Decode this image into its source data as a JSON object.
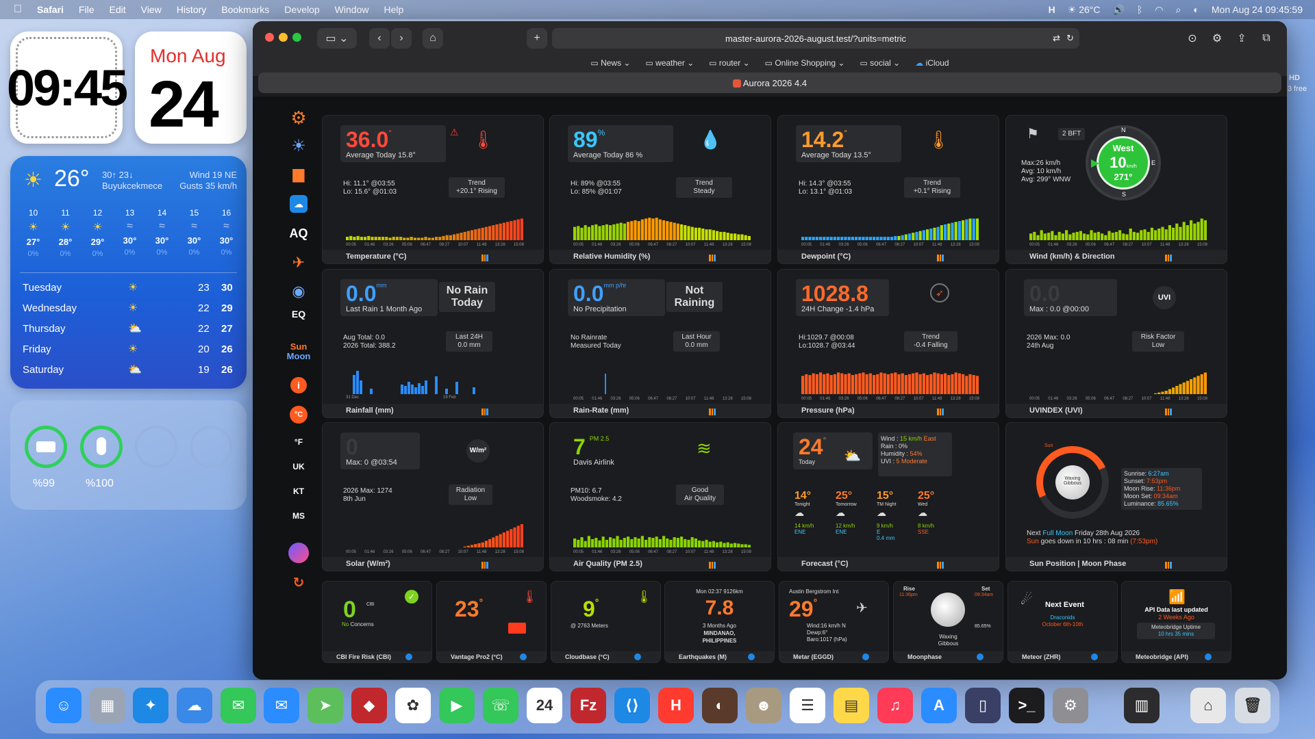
{
  "menubar": {
    "app": "Safari",
    "menus": [
      "File",
      "Edit",
      "View",
      "History",
      "Bookmarks",
      "Develop",
      "Window",
      "Help"
    ],
    "temp": "26°C",
    "datetime": "Mon Aug 24  09:45:59"
  },
  "widgets": {
    "clock": "09:45",
    "date_day": "Mon Aug",
    "date_num": "24",
    "weather": {
      "temp": "26°",
      "hilo": "30↑ 23↓",
      "location": "Buyukcekmece",
      "wind": "Wind 19 NE",
      "gusts": "Gusts 35 km/h",
      "hours": [
        "10",
        "11",
        "12",
        "13",
        "14",
        "15",
        "16"
      ],
      "hour_temps": [
        "27°",
        "28°",
        "29°",
        "30°",
        "30°",
        "30°",
        "30°"
      ],
      "hour_pops": [
        "0%",
        "0%",
        "0%",
        "0%",
        "0%",
        "0%",
        "0%"
      ],
      "days": [
        {
          "name": "Tuesday",
          "lo": "23",
          "hi": "30"
        },
        {
          "name": "Wednesday",
          "lo": "22",
          "hi": "29"
        },
        {
          "name": "Thursday",
          "lo": "22",
          "hi": "27"
        },
        {
          "name": "Friday",
          "lo": "20",
          "hi": "26"
        },
        {
          "name": "Saturday",
          "lo": "19",
          "hi": "26"
        }
      ]
    },
    "battery": [
      {
        "label": "%99",
        "level": 0.99
      },
      {
        "label": "%100",
        "level": 1.0
      }
    ],
    "side_text": [
      "HD",
      "3 free"
    ]
  },
  "browser": {
    "url": "master-aurora-2026-august.test/?units=metric",
    "bookmarks": [
      "News",
      "weather",
      "router",
      "Online Shopping",
      "social",
      "iCloud"
    ],
    "tab_title": "Aurora 2026 4.4"
  },
  "sidebar": {
    "aq": "AQ",
    "eq": "EQ",
    "sun": "Sun",
    "moon": "Moon",
    "units": [
      "°C",
      "°F",
      "UK",
      "KT",
      "MS"
    ]
  },
  "cards": {
    "temperature": {
      "value": "36.0",
      "unit": "°",
      "avg": "Average Today 15.8°",
      "hi": "Hi: 11.1° @03:55",
      "lo": "Lo: 15.6° @01:03",
      "trend_title": "Trend",
      "trend": "+20.1° Rising",
      "footer": "Temperature (°C)"
    },
    "humidity": {
      "value": "89",
      "unit": "%",
      "avg": "Average Today 86 %",
      "hi": "Hi: 89% @03:55",
      "lo": "Lo: 85% @01:07",
      "trend_title": "Trend",
      "trend": "Steady",
      "footer": "Relative Humidity (%)"
    },
    "dewpoint": {
      "value": "14.2",
      "unit": "°",
      "avg": "Average Today 13.5°",
      "hi": "Hi: 14.3° @03:55",
      "lo": "Lo: 13.1° @01:03",
      "trend_title": "Trend",
      "trend": "+0.1° Rising",
      "footer": "Dewpoint (°C)"
    },
    "wind": {
      "bft": "2 BFT",
      "max": "Max:26 km/h",
      "avg": "Avg: 10 km/h",
      "dir_avg": "Avg: 299° WNW",
      "dir": "West",
      "speed": "10",
      "speed_unit": "km/h",
      "deg": "271°",
      "n": "N",
      "e": "E",
      "s": "S",
      "footer": "Wind (km/h) & Direction"
    },
    "rainfall": {
      "value": "0.0",
      "unit": "mm",
      "sub": "Last Rain 1 Month Ago",
      "status": "No Rain Today",
      "aug": "Aug Total: 0.0",
      "year": "2026 Total: 388.2",
      "last24_title": "Last 24H",
      "last24": "0.0 mm",
      "tick_a": "31 Dec",
      "tick_b": "19 Feb",
      "footer": "Rainfall (mm)"
    },
    "rainrate": {
      "value": "0.0",
      "unit": "mm p/hr",
      "sub": "No Precipitation",
      "status": "Not Raining",
      "n1": "No Rainrate",
      "n2": "Measured Today",
      "lh_title": "Last Hour",
      "lh": "0.0 mm",
      "footer": "Rain-Rate (mm)"
    },
    "pressure": {
      "value": "1028.8",
      "sub": "24H Change -1.4 hPa",
      "hi": "Hi:1029.7 @00:08",
      "lo": "Lo:1028.7 @03:44",
      "trend_title": "Trend",
      "trend": "-0.4 Falling",
      "footer": "Pressure (hPa)"
    },
    "uv": {
      "value": "0.0",
      "sub": "Max : 0.0 @00:00",
      "badge": "UVI",
      "max": "2026 Max: 0.0",
      "date": "24th Aug",
      "risk_title": "Risk Factor",
      "risk": "Low",
      "footer": "UVINDEX (UVI)"
    },
    "solar": {
      "value": "0",
      "sub": "Max: 0 @03:54",
      "badge": "W/m²",
      "max": "2026 Max: 1274",
      "date": "8th Jun",
      "rad_title": "Radiation",
      "rad": "Low",
      "footer": "Solar (W/m²)"
    },
    "air": {
      "value": "7",
      "unit": "PM 2.5",
      "sub": "Davis Airlink",
      "pm10": "PM10: 6.7",
      "smoke": "Woodsmoke: 4.2",
      "q_title": "Good",
      "q": "Air Quality",
      "footer": "Air Quality (PM 2.5)"
    },
    "forecast": {
      "value": "24",
      "unit": "°",
      "sub": "Today",
      "wind_label": "Wind :",
      "wind_speed": "15 km/h",
      "wind_dir": "East",
      "rain": "Rain : 0%",
      "hum_label": "Humidity :",
      "hum": "54%",
      "uvi_label": "UVI :",
      "uvi": "5 Moderate",
      "periods": [
        {
          "t": "14°",
          "n": "Tonight",
          "w": "14 km/h",
          "d": "ENE",
          "r": ""
        },
        {
          "t": "25°",
          "n": "Tomorrow",
          "w": "12 km/h",
          "d": "ENE",
          "r": ""
        },
        {
          "t": "15°",
          "n": "TM Night",
          "w": "9 km/h",
          "d": "E",
          "r": "0.4 mm"
        },
        {
          "t": "25°",
          "n": "Wed",
          "w": "8 km/h",
          "d": "SSE",
          "r": ""
        }
      ],
      "footer": "Forecast (°C)"
    },
    "sunmoon": {
      "phase": "Waxing Gibbous",
      "sun_label": "Sun",
      "sunrise_l": "Sunrise:",
      "sunrise": "6:27am",
      "sunset_l": "Sunset:",
      "sunset": "7:53pm",
      "mrise_l": "Moon Rise:",
      "mrise": "11:36pm",
      "mset_l": "Moon Set:",
      "mset": "09:34am",
      "lum_l": "Luminance:",
      "lum": "85.65%",
      "next1": "Next",
      "next2": "Full Moon",
      "next3": "Friday 28th Aug 2026",
      "down1": "Sun",
      "down2": "goes down in 10 hrs : 08 min",
      "down3": "(7:53pm)",
      "footer": "Sun Position | Moon Phase"
    }
  },
  "mini": {
    "fire": {
      "value": "0",
      "unit": "CBI",
      "sub": "No",
      "sub2": "Concerns",
      "footer": "CBI Fire Risk (CBI)"
    },
    "vantage": {
      "value": "23",
      "unit": "°",
      "footer": "Vantage Pro2 (°C)"
    },
    "cloud": {
      "value": "9",
      "unit": "°",
      "sub": "@ 2763 Meters",
      "footer": "Cloudbase (°C)"
    },
    "quake": {
      "top": "Mon 02:37 9126km",
      "value": "7.8",
      "sub1": "3 Months Ago",
      "sub2": "MINDANAO,",
      "sub3": "PHILIPPINES",
      "footer": "Earthquakes (M)"
    },
    "metar": {
      "top": "Austin Bergstrom Int",
      "value": "29",
      "unit": "°",
      "l1": "Wind:16 km/h N",
      "l2": "Dewp:6°",
      "l3": "Baro:1017 (hPa)",
      "footer": "Metar (EGGD)"
    },
    "moon": {
      "rise_l": "Rise",
      "rise": "11:36pm",
      "set_l": "Set",
      "set": "09:34am",
      "phase1": "Waxing",
      "phase2": "Gibbous",
      "lum": "85.65%",
      "footer": "Moonphase"
    },
    "meteor": {
      "title": "Next Event",
      "name": "Draconids",
      "date": "October 6th-10th",
      "footer": "Meteor (ZHR)"
    },
    "api": {
      "l1": "API Data last updated",
      "l2": "2 Weeks Ago",
      "l3": "Meteobridge Uptime",
      "l4": "10 hrs 35 mins",
      "footer": "Meteobridge (API)"
    }
  },
  "charts": {
    "temperature_bars": [
      4,
      5,
      4,
      5,
      4,
      4,
      5,
      4,
      4,
      4,
      4,
      4,
      3,
      4,
      4,
      4,
      3,
      3,
      4,
      3,
      3,
      3,
      4,
      3,
      3,
      4,
      4,
      5,
      6,
      6,
      7,
      8,
      9,
      10,
      11,
      12,
      13,
      14,
      15,
      16,
      17,
      18,
      19,
      20,
      21,
      22,
      23,
      24,
      25,
      26
    ],
    "humidity_bars": [
      16,
      17,
      15,
      18,
      16,
      18,
      19,
      17,
      18,
      19,
      18,
      19,
      20,
      21,
      20,
      22,
      23,
      24,
      23,
      25,
      26,
      27,
      26,
      27,
      25,
      24,
      23,
      22,
      21,
      20,
      19,
      18,
      17,
      16,
      15,
      15,
      14,
      13,
      13,
      12,
      11,
      10,
      10,
      9,
      8,
      8,
      7,
      7,
      6,
      5
    ],
    "dewpoint_bars": [
      4,
      4,
      4,
      4,
      4,
      4,
      4,
      4,
      4,
      4,
      4,
      4,
      4,
      4,
      4,
      4,
      4,
      4,
      4,
      4,
      4,
      4,
      4,
      4,
      4,
      4,
      5,
      5,
      6,
      7,
      8,
      9,
      10,
      11,
      12,
      13,
      14,
      15,
      16,
      18,
      19,
      20,
      21,
      22,
      23,
      24,
      25,
      26,
      26,
      26
    ],
    "wind_bars": [
      8,
      10,
      6,
      12,
      8,
      9,
      11,
      6,
      10,
      8,
      12,
      7,
      9,
      10,
      11,
      8,
      7,
      12,
      9,
      10,
      8,
      6,
      11,
      9,
      10,
      12,
      8,
      7,
      14,
      10,
      9,
      12,
      13,
      10,
      15,
      12,
      14,
      16,
      13,
      18,
      15,
      20,
      16,
      22,
      18,
      24,
      20,
      22,
      26,
      24
    ],
    "rainfall_bars": [
      0,
      0,
      28,
      34,
      20,
      0,
      0,
      8,
      0,
      0,
      0,
      0,
      0,
      0,
      0,
      0,
      14,
      12,
      18,
      14,
      10,
      16,
      12,
      20,
      0,
      0,
      26,
      0,
      0,
      8,
      0,
      0,
      18,
      0,
      0,
      0,
      0,
      10,
      0,
      0
    ],
    "pressure_bars": [
      22,
      24,
      23,
      25,
      24,
      26,
      24,
      25,
      23,
      24,
      26,
      25,
      24,
      25,
      23,
      24,
      25,
      26,
      24,
      25,
      23,
      24,
      26,
      25,
      24,
      25,
      26,
      24,
      25,
      23,
      24,
      25,
      26,
      24,
      25,
      23,
      24,
      26,
      25,
      24,
      25,
      23,
      24,
      26,
      25,
      24,
      22,
      24,
      23,
      22
    ],
    "uv_bars": [
      0,
      0,
      0,
      0,
      0,
      0,
      0,
      0,
      0,
      0,
      0,
      0,
      0,
      0,
      0,
      0,
      0,
      0,
      0,
      0,
      0,
      0,
      0,
      0,
      0,
      0,
      0,
      0,
      0,
      0,
      0,
      0,
      0,
      0,
      0,
      1,
      2,
      3,
      4,
      6,
      8,
      10,
      12,
      14,
      16,
      18,
      20,
      22,
      24,
      26
    ],
    "solar_bars": [
      0,
      0,
      0,
      0,
      0,
      0,
      0,
      0,
      0,
      0,
      0,
      0,
      0,
      0,
      0,
      0,
      0,
      0,
      0,
      0,
      0,
      0,
      0,
      0,
      0,
      0,
      0,
      0,
      0,
      0,
      0,
      0,
      0,
      1,
      2,
      3,
      4,
      5,
      6,
      8,
      10,
      12,
      14,
      16,
      18,
      20,
      22,
      24,
      26,
      28
    ],
    "air_bars": [
      14,
      12,
      16,
      10,
      18,
      13,
      15,
      11,
      17,
      12,
      16,
      14,
      18,
      12,
      15,
      17,
      13,
      16,
      14,
      18,
      12,
      16,
      15,
      17,
      13,
      18,
      14,
      12,
      16,
      15,
      17,
      13,
      12,
      16,
      14,
      11,
      10,
      12,
      9,
      10,
      8,
      9,
      7,
      8,
      6,
      7,
      6,
      5,
      5,
      4
    ],
    "time_ticks": [
      "00:05",
      "01:46",
      "03:26",
      "05:06",
      "06:47",
      "08:27",
      "10:07",
      "11:48",
      "13:28",
      "15:08"
    ]
  }
}
